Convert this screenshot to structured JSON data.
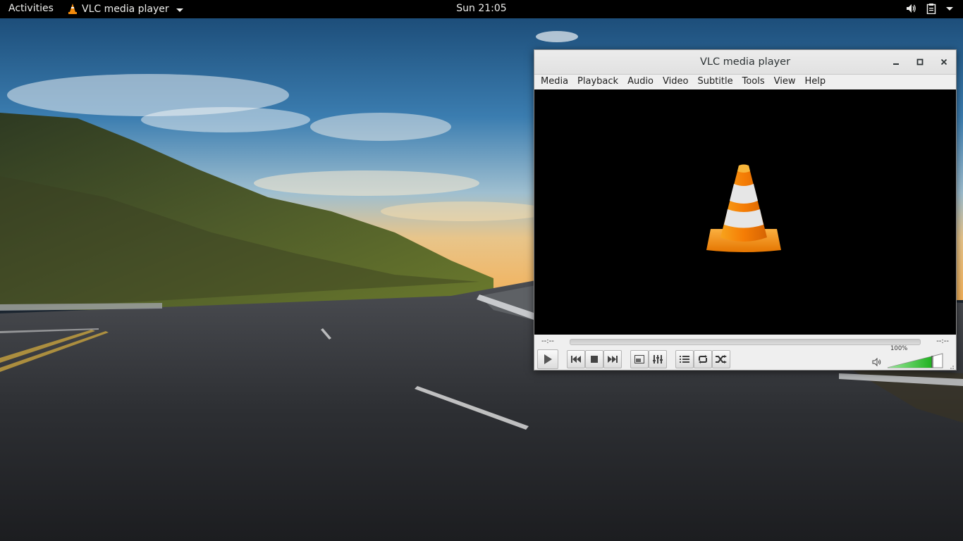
{
  "topbar": {
    "activities": "Activities",
    "app_name": "VLC media player",
    "clock": "Sun 21:05",
    "icons": [
      "volume-icon",
      "clipboard-icon",
      "caret-down-icon"
    ]
  },
  "window": {
    "title": "VLC media player",
    "menu": [
      "Media",
      "Playback",
      "Audio",
      "Video",
      "Subtitle",
      "Tools",
      "View",
      "Help"
    ],
    "menu_mnemonics": [
      "M",
      "l",
      "A",
      "V",
      "t",
      "T",
      "i",
      "H"
    ]
  },
  "player": {
    "time_current": "--:--",
    "time_total": "--:--",
    "seek_progress": 0,
    "volume_label": "100%",
    "volume_level": 1.0
  },
  "colors": {
    "cone_orange": "#f28a0c",
    "volume_green": "#27c12a",
    "topbar": "#000000"
  }
}
